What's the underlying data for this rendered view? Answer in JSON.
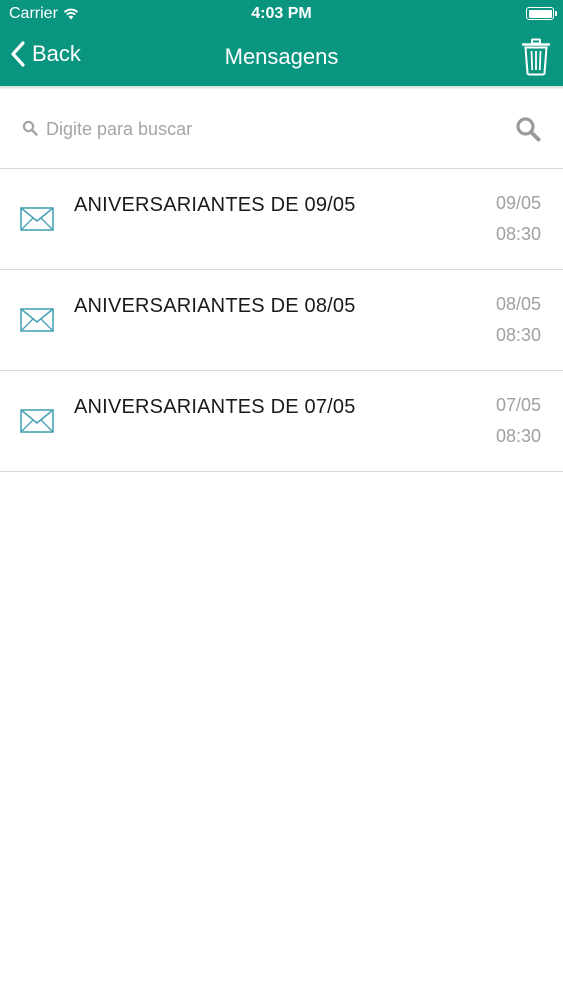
{
  "status_bar": {
    "carrier": "Carrier",
    "time": "4:03 PM",
    "battery_level": 1.0
  },
  "nav": {
    "back_label": "Back",
    "title": "Mensagens",
    "trash_icon": "trash-icon"
  },
  "search": {
    "placeholder": "Digite para buscar",
    "value": ""
  },
  "messages": [
    {
      "title": "ANIVERSARIANTES DE 09/05",
      "date": "09/05",
      "time": "08:30",
      "icon": "envelope-icon"
    },
    {
      "title": "ANIVERSARIANTES DE 08/05",
      "date": "08/05",
      "time": "08:30",
      "icon": "envelope-icon"
    },
    {
      "title": "ANIVERSARIANTES DE 07/05",
      "date": "07/05",
      "time": "08:30",
      "icon": "envelope-icon"
    }
  ],
  "colors": {
    "header": "#0a9580",
    "envelope": "#4aa3b5",
    "secondary_text": "#a0a0a0"
  }
}
